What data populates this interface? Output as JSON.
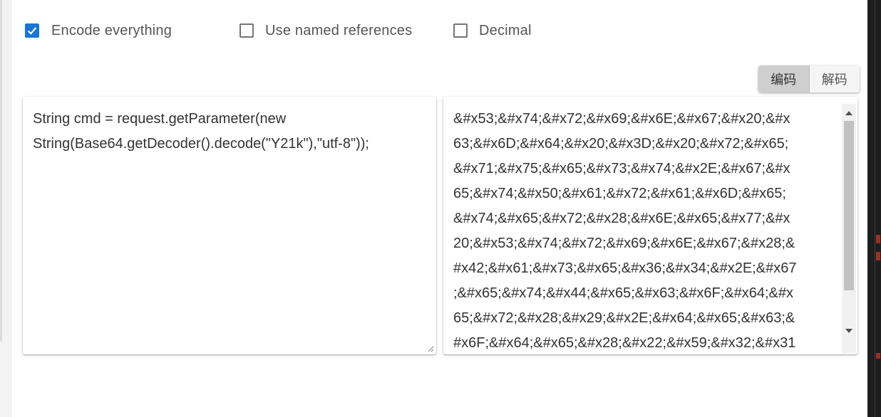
{
  "options": [
    {
      "label": "Encode everything",
      "checked": true
    },
    {
      "label": "Use named references",
      "checked": false
    },
    {
      "label": "Decimal",
      "checked": false
    }
  ],
  "mode_buttons": {
    "encode": "编码",
    "decode": "解码",
    "active": "encode"
  },
  "input": {
    "lines": [
      "String cmd = request.getParameter(new",
      "String(Base64.getDecoder().decode(\"Y21k\"),\"utf-8\"));"
    ]
  },
  "output": {
    "lines": [
      "&#x53;&#x74;&#x72;&#x69;&#x6E;&#x67;&#x20;&#x",
      "63;&#x6D;&#x64;&#x20;&#x3D;&#x20;&#x72;&#x65;",
      "&#x71;&#x75;&#x65;&#x73;&#x74;&#x2E;&#x67;&#x",
      "65;&#x74;&#x50;&#x61;&#x72;&#x61;&#x6D;&#x65;",
      "&#x74;&#x65;&#x72;&#x28;&#x6E;&#x65;&#x77;&#x",
      "20;&#x53;&#x74;&#x72;&#x69;&#x6E;&#x67;&#x28;&",
      "#x42;&#x61;&#x73;&#x65;&#x36;&#x34;&#x2E;&#x67",
      ";&#x65;&#x74;&#x44;&#x65;&#x63;&#x6F;&#x64;&#x",
      "65;&#x72;&#x28;&#x29;&#x2E;&#x64;&#x65;&#x63;&",
      "#x6F;&#x64;&#x65;&#x28;&#x22;&#x59;&#x32;&#x31"
    ]
  },
  "colors": {
    "accent": "#1976d2"
  }
}
